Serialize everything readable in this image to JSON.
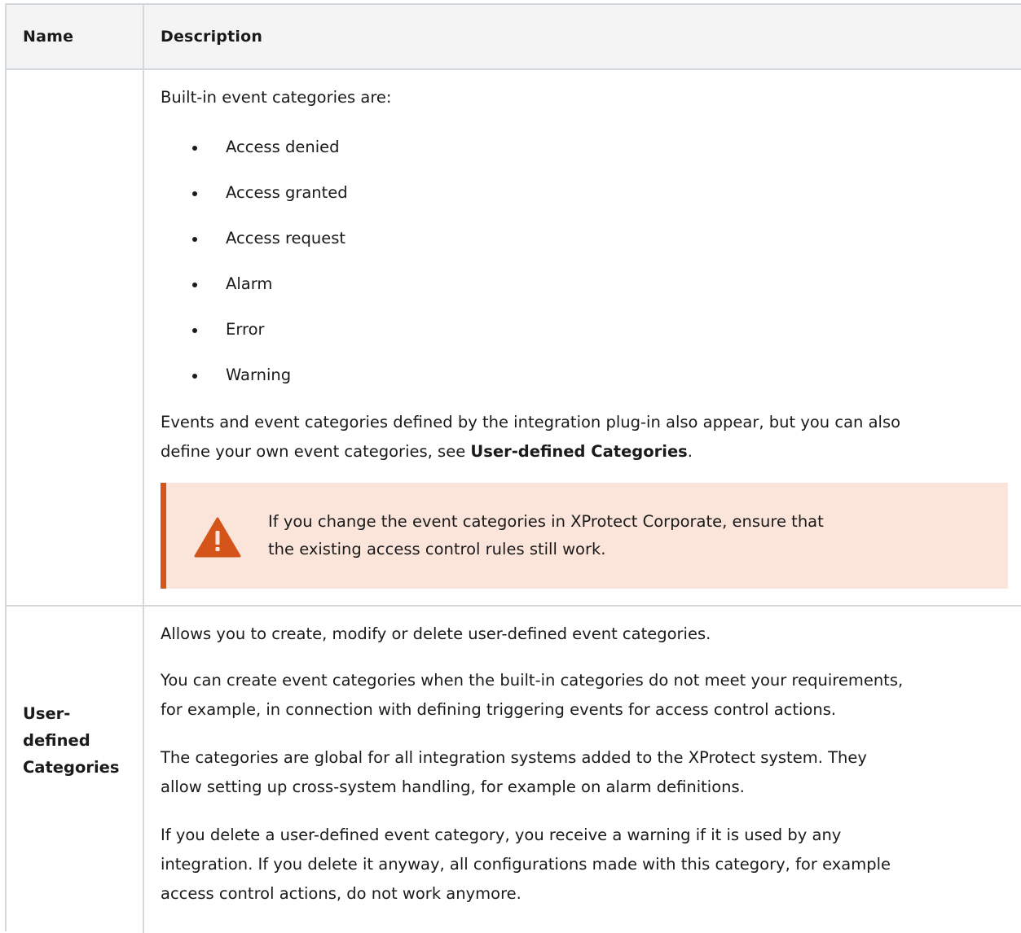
{
  "table": {
    "headers": {
      "name": "Name",
      "description": "Description"
    },
    "row1": {
      "intro": "Built-in event categories are:",
      "categories": [
        "Access denied",
        "Access granted",
        "Access request",
        "Alarm",
        "Error",
        "Warning"
      ],
      "note_line1": "Events and event categories defined by the integration plug-in also appear, but you can also",
      "note_line2_pre": "define your own event categories, see ",
      "note_line2_bold": "User-defined Categories",
      "note_line2_post": ".",
      "warning": {
        "icon": "warning-triangle-icon",
        "line1": "If you change the event categories in XProtect Corporate, ensure that",
        "line2": "the existing access control rules still work.",
        "accent_color": "#d4541a",
        "background_color": "#fbe5da"
      }
    },
    "row2": {
      "name_lines": [
        "User-",
        "defined",
        "Categories"
      ],
      "paragraphs": [
        [
          "Allows you to create, modify or delete user-defined event categories."
        ],
        [
          "You can create event categories when the built-in categories do not meet your requirements,",
          "for example, in connection with defining triggering events for access control actions."
        ],
        [
          "The categories are global for all integration systems added to the XProtect system. They",
          "allow setting up cross-system handling, for example on alarm definitions."
        ],
        [
          "If you delete a user-defined event category, you receive a warning if it is used by any",
          "integration. If you delete it anyway, all configurations made with this category, for example",
          "access control actions, do not work anymore."
        ]
      ]
    }
  }
}
